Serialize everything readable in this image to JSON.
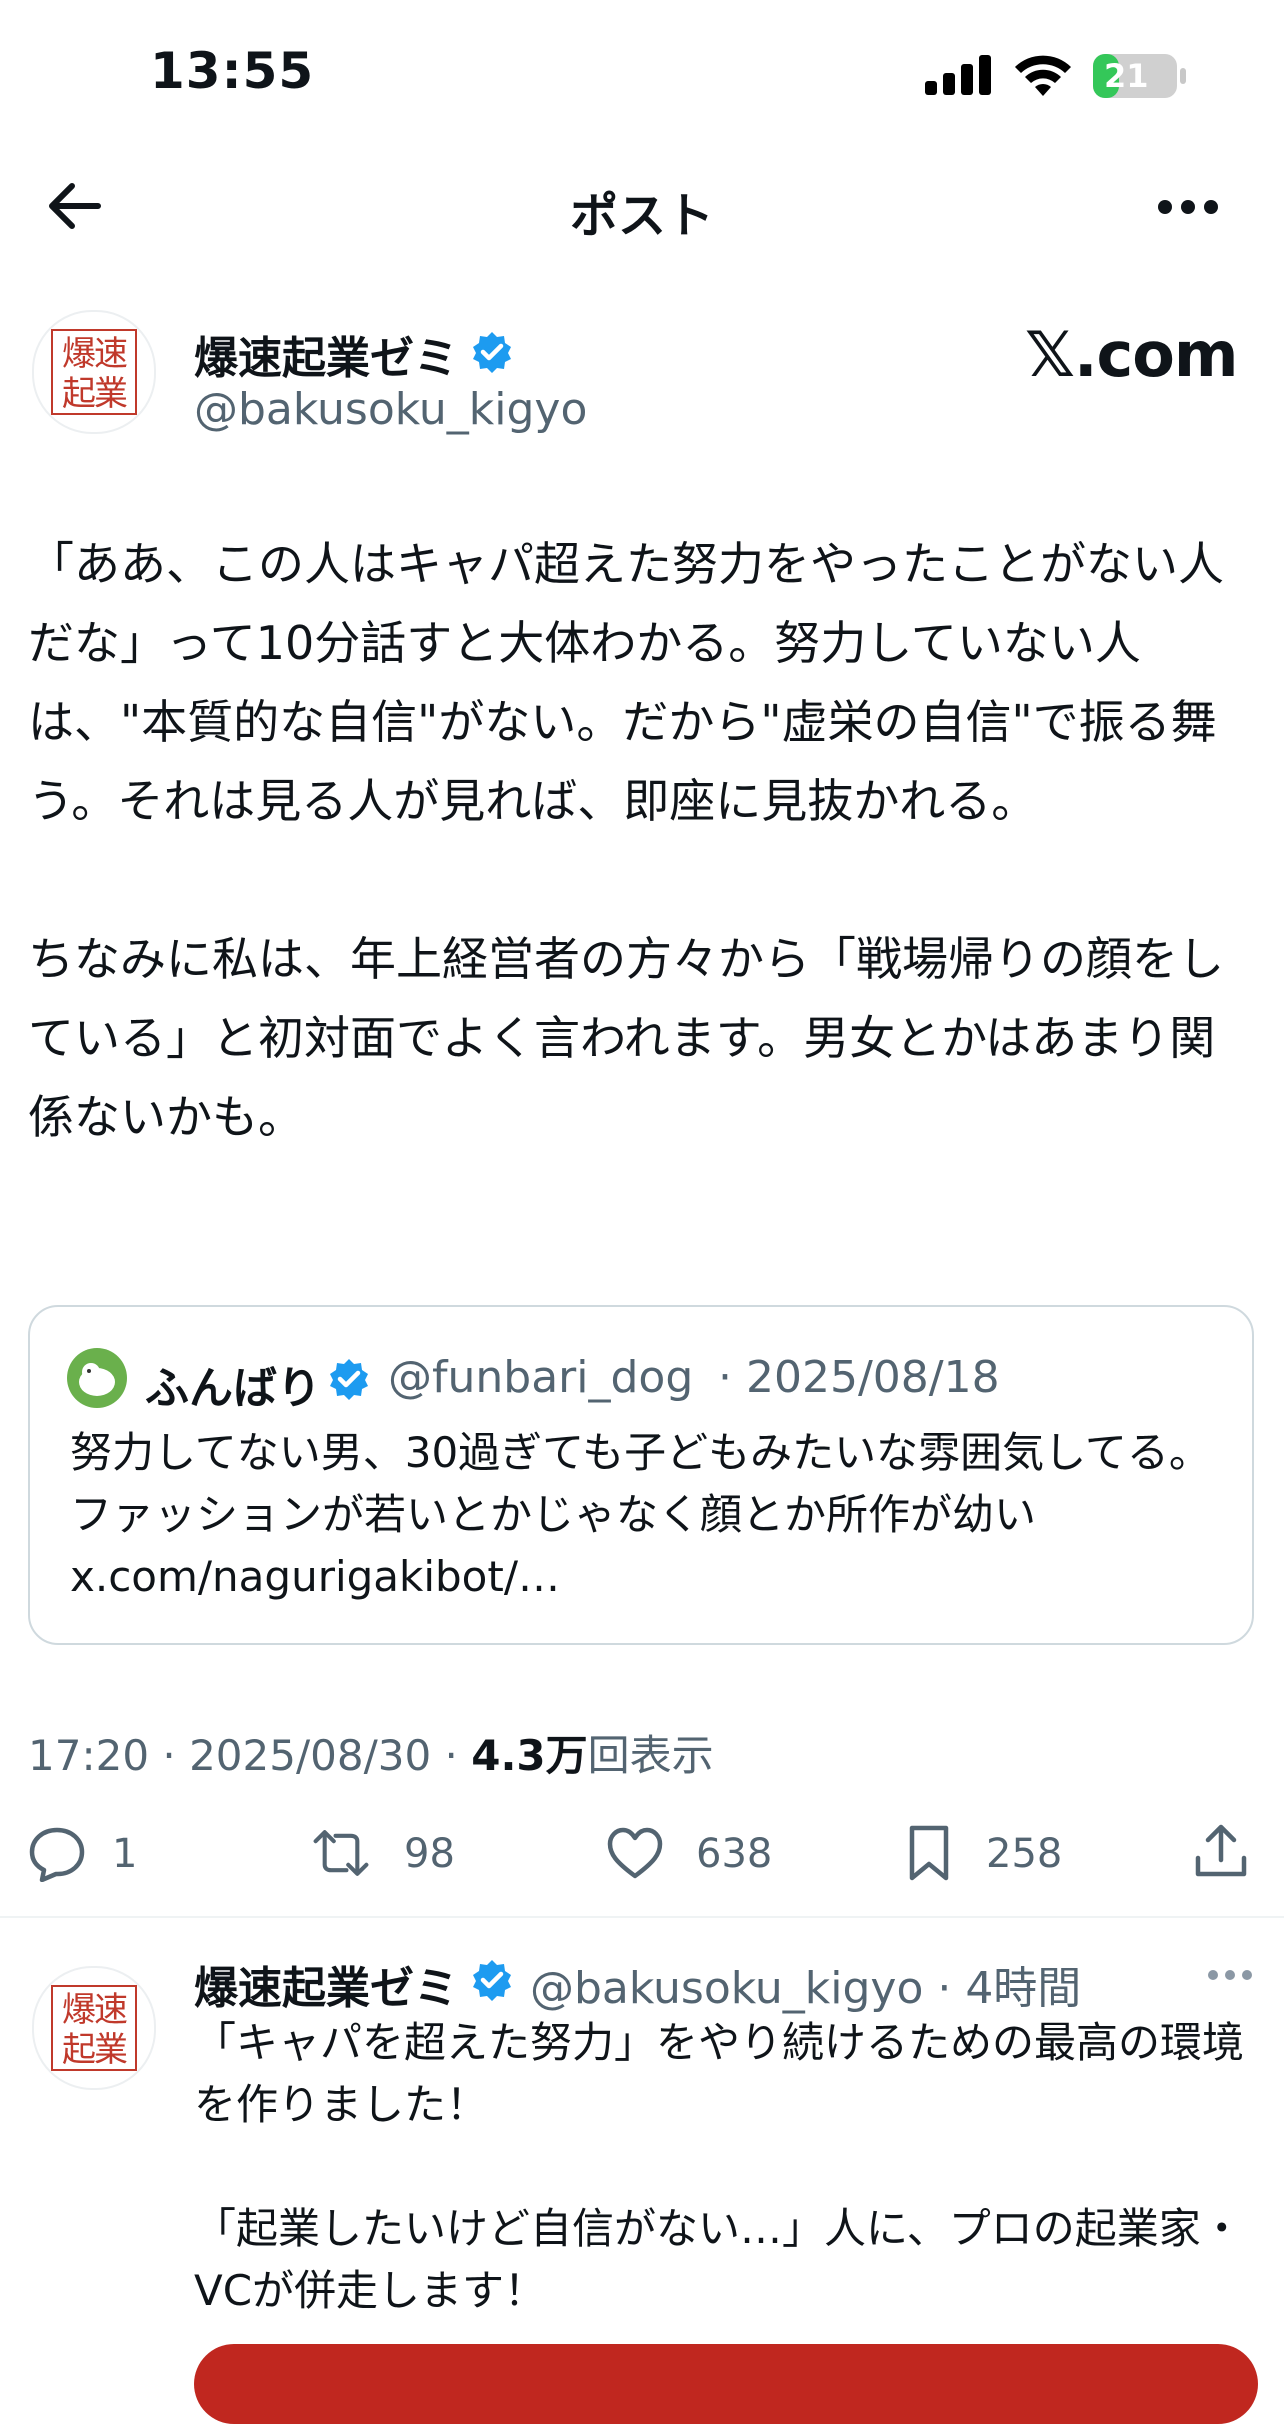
{
  "status_bar": {
    "time": "13:55",
    "battery_level": "21"
  },
  "nav": {
    "title": "ポスト"
  },
  "post": {
    "author": {
      "name": "爆速起業ゼミ",
      "handle": "@bakusoku_kigyo",
      "avatar_text_line1": "爆速",
      "avatar_text_line2": "起業"
    },
    "source_badge": "𝕏.com",
    "text": "「ああ、この人はキャパ超えた努力をやったことがない人だな」って10分話すと大体わかる。努力していない人は、\"本質的な自信\"がない。だから\"虚栄の自信\"で振る舞う。それは見る人が見れば、即座に見抜かれる。\n\nちなみに私は、年上経営者の方々から「戦場帰りの顔をしている」と初対面でよく言われます。男女とかはあまり関係ないかも。",
    "quote": {
      "name": "ふんばり",
      "handle": "@funbari_dog",
      "date": "· 2025/08/18",
      "text": "努力してない男、30過ぎても子どもみたいな雰囲気してる。ファッションが若いとかじゃなく顔とか所作が幼い\nx.com/nagurigakibot/…"
    },
    "meta": {
      "time_date": "17:20 · 2025/08/30 · ",
      "views_number": "4.3万",
      "views_label": "回表示"
    },
    "actions": {
      "replies": "1",
      "reposts": "98",
      "likes": "638",
      "bookmarks": "258"
    }
  },
  "reply": {
    "name": "爆速起業ゼミ",
    "handle_time": "@bakusoku_kigyo · 4時間",
    "text": "「キャパを超えた努力」をやり続けるための最高の環境を作りました！\n\n「起業したいけど自信がない…」人に、プロの起業家・VCが併走します！"
  },
  "colors": {
    "verified": "#1d9bf0",
    "secondary_text": "#536471",
    "seal_red": "#c0392b",
    "ad_button": "#c0271f"
  },
  "icons": [
    "back-arrow-icon",
    "more-icon",
    "verified-badge-icon",
    "reply-icon",
    "repost-icon",
    "like-icon",
    "bookmark-icon",
    "share-icon",
    "signal-icon",
    "wifi-icon",
    "battery-icon"
  ]
}
